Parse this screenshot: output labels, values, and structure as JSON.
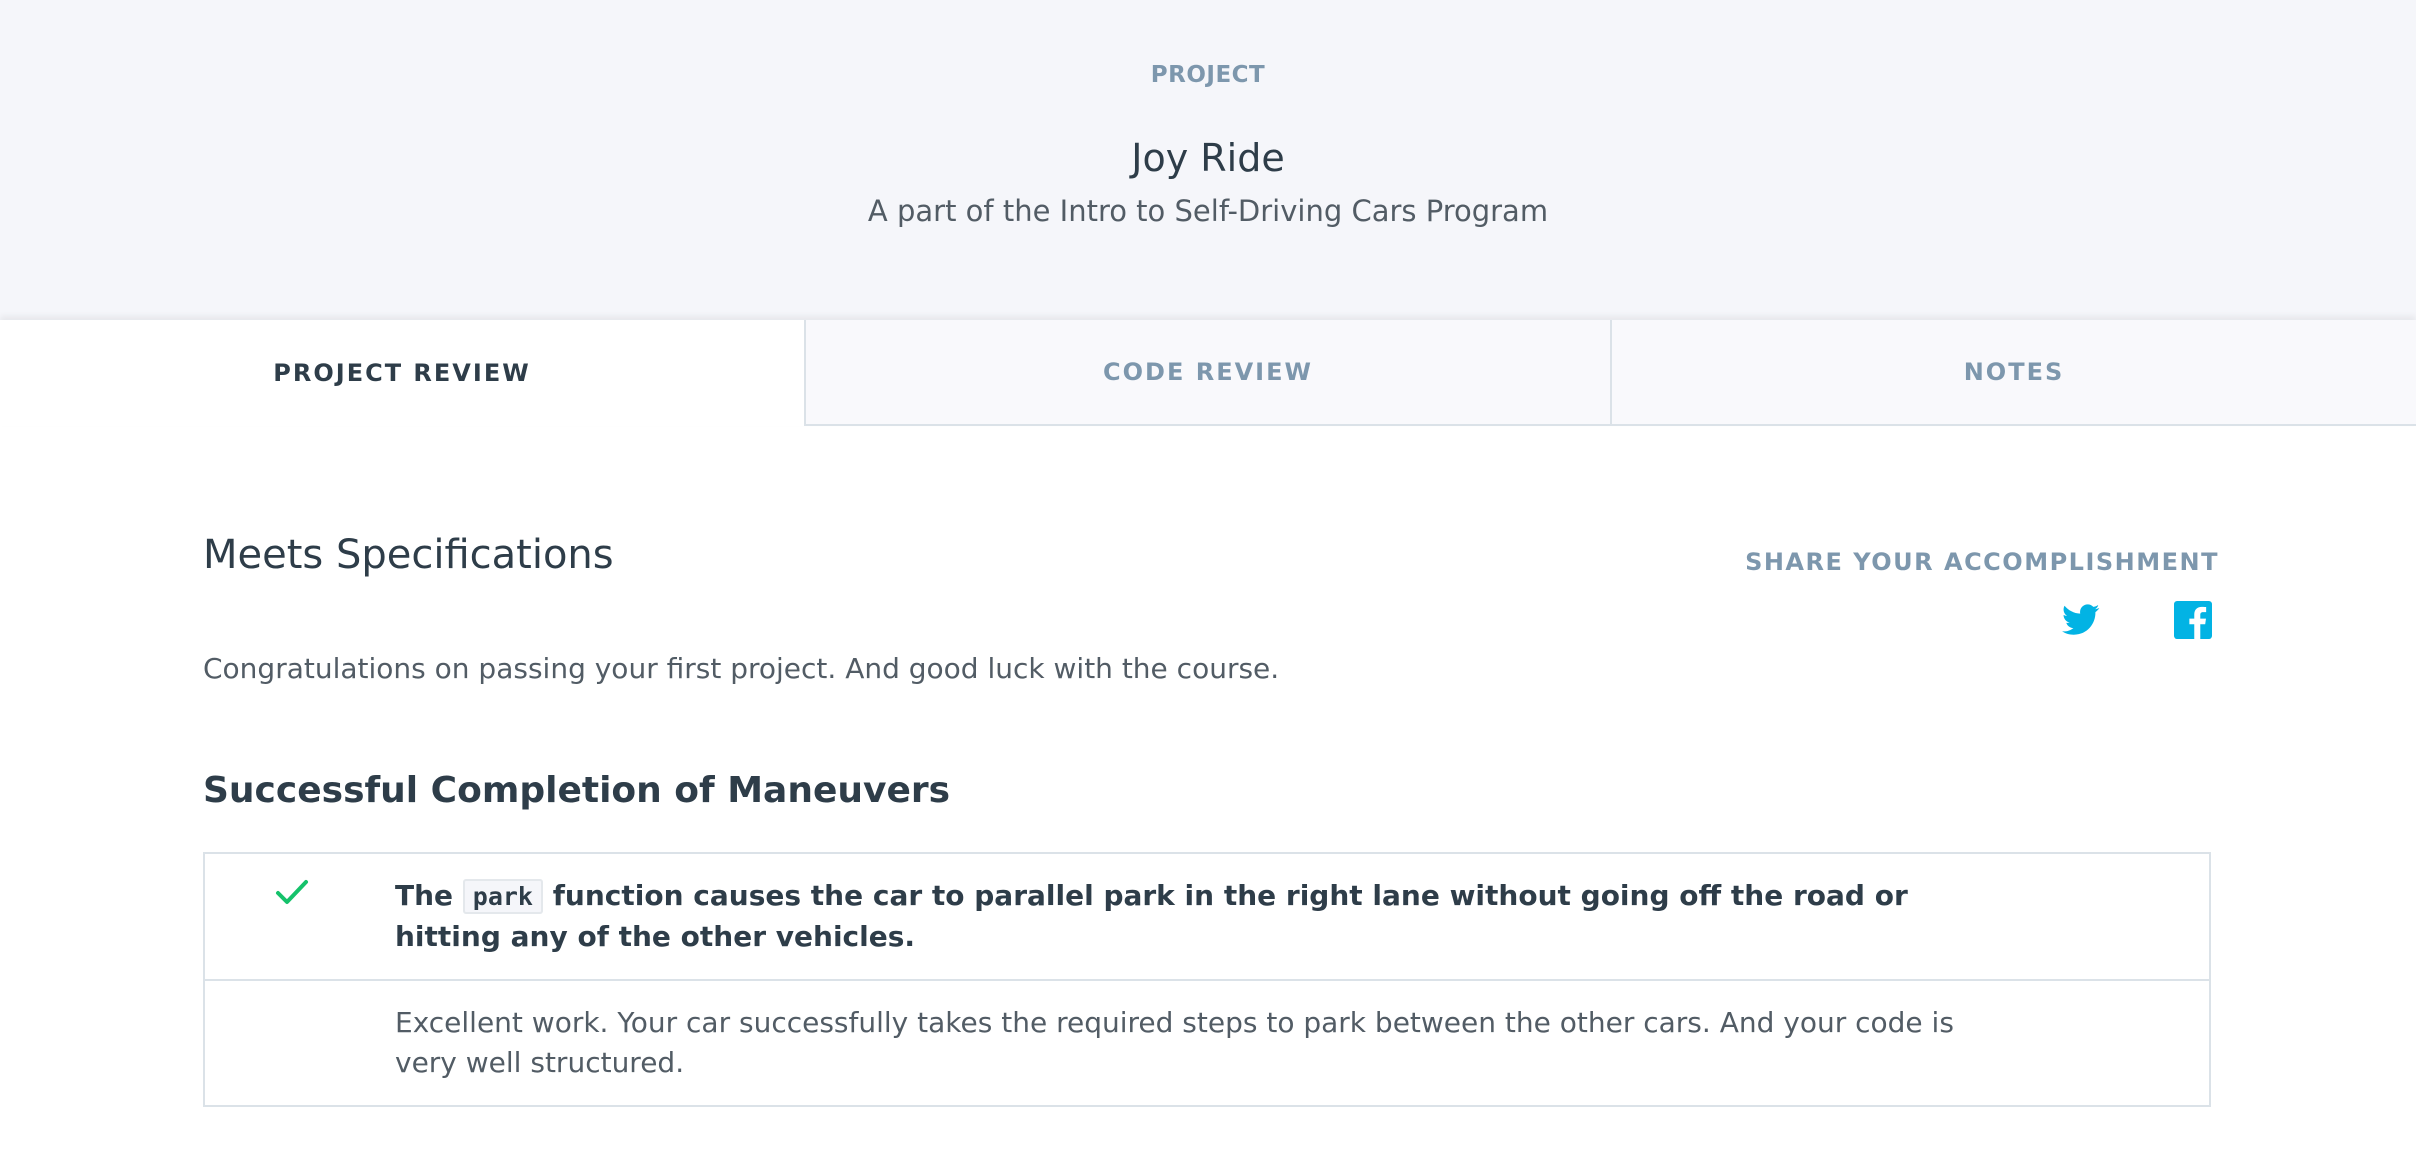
{
  "header": {
    "eyebrow": "PROJECT",
    "title": "Joy Ride",
    "subtitle": "A part of the Intro to Self-Driving Cars Program"
  },
  "tabs": [
    {
      "label": "PROJECT REVIEW",
      "active": true
    },
    {
      "label": "CODE REVIEW",
      "active": false
    },
    {
      "label": "NOTES",
      "active": false
    }
  ],
  "review": {
    "status": "Meets Specifications",
    "share_label": "SHARE YOUR ACCOMPLISHMENT",
    "share_icons": [
      "twitter-icon",
      "facebook-icon"
    ],
    "summary": "Congratulations on passing your first project. And good luck with the course."
  },
  "section": {
    "title": "Successful Completion of Maneuvers",
    "criteria": {
      "status_icon": "checkmark-icon",
      "text_before": "The ",
      "code": "park",
      "text_after": " function causes the car to parallel park in the right lane without going off the road or hitting any of the other vehicles."
    },
    "feedback": "Excellent work. Your car successfully takes the required steps to park between the other cars. And your code is very well structured."
  },
  "colors": {
    "header_bg": "#f5f6fa",
    "muted_text": "#7d97ad",
    "heading_text": "#2e3d49",
    "pass_green": "#02b3e4",
    "check_green": "#15c26b",
    "social_blue": "#02b3e4",
    "border": "#dbe2e8"
  }
}
